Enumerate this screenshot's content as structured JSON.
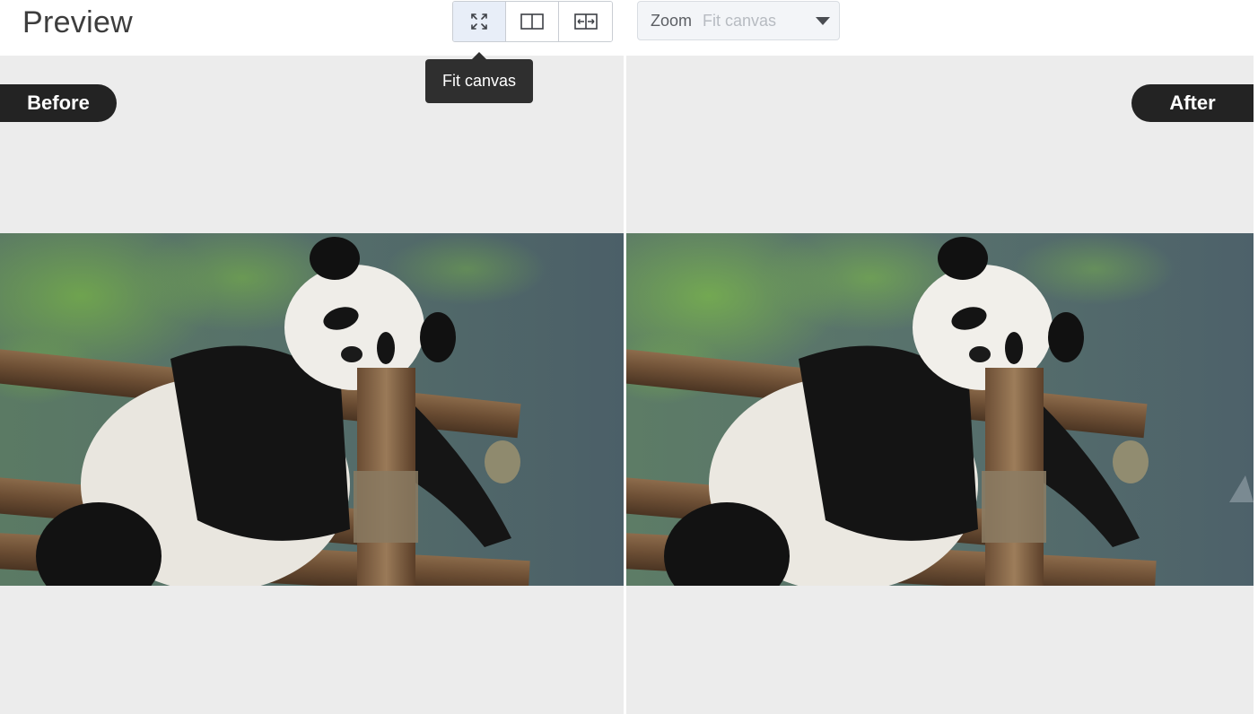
{
  "header": {
    "title": "Preview"
  },
  "view_modes": [
    {
      "name": "fit-canvas",
      "icon": "fit-canvas-icon",
      "active": true
    },
    {
      "name": "split-view",
      "icon": "split-view-icon",
      "active": false
    },
    {
      "name": "side-by-side",
      "icon": "side-by-side-icon",
      "active": false
    }
  ],
  "zoom": {
    "label": "Zoom",
    "value": "Fit canvas"
  },
  "tooltip": {
    "text": "Fit canvas"
  },
  "panels": {
    "before_label": "Before",
    "after_label": "After"
  },
  "colors": {
    "accent_active": "#e8eef8",
    "canvas_bg": "#ececec",
    "badge_bg": "#232323"
  }
}
